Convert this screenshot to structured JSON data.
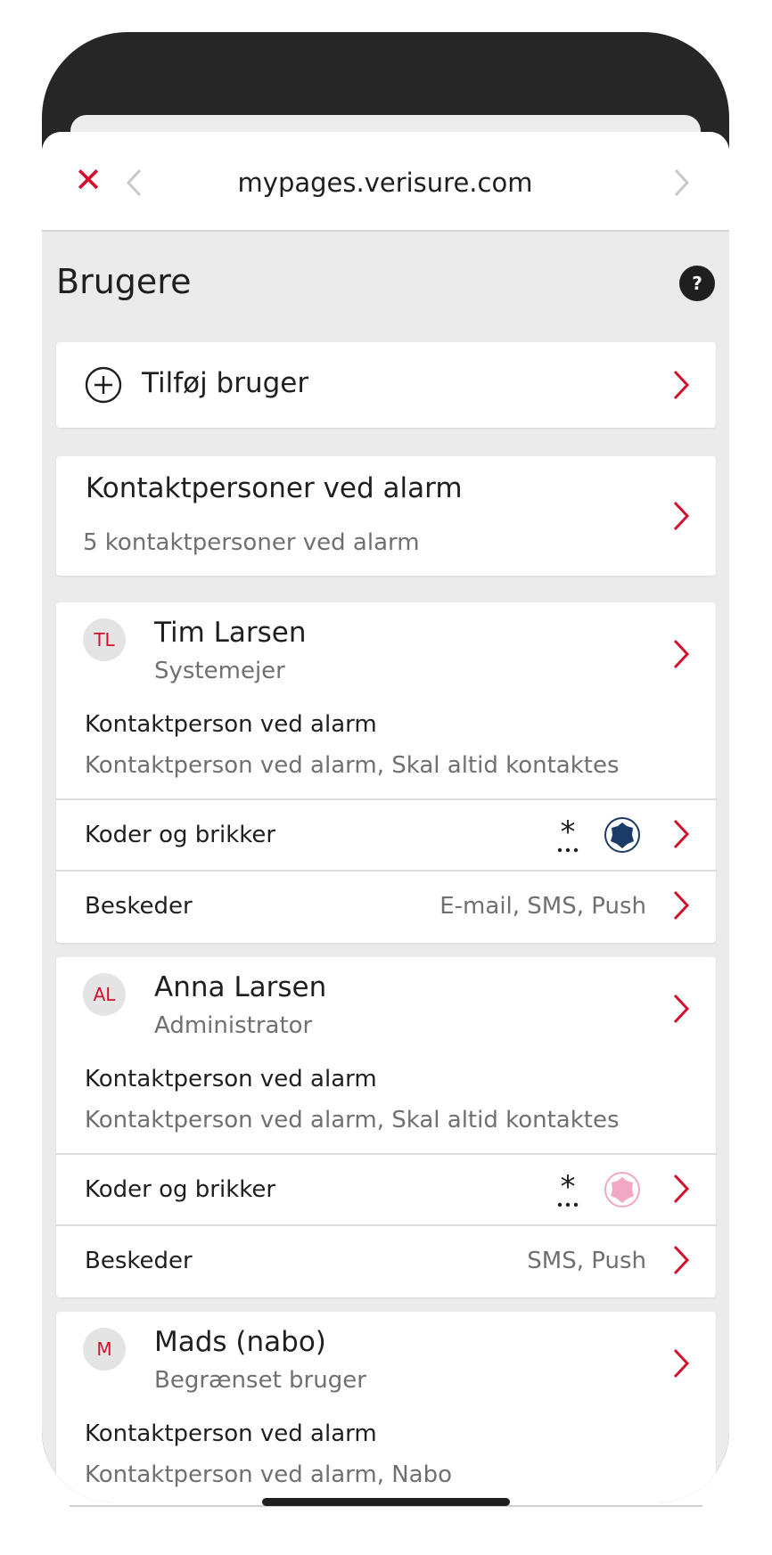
{
  "browser": {
    "url": "mypages.verisure.com",
    "close_icon": "close-icon",
    "accent": "#d4112c"
  },
  "page": {
    "title": "Brugere",
    "help_label": "?"
  },
  "add_user": {
    "label": "Tilføj bruger"
  },
  "alarm_contacts": {
    "title": "Kontaktpersoner ved alarm",
    "subtitle": "5 kontaktpersoner ved alarm"
  },
  "users": [
    {
      "initials": "TL",
      "name": "Tim Larsen",
      "role": "Systemejer",
      "contact_label": "Kontaktperson ved alarm",
      "contact_value": "Kontaktperson ved alarm, Skal altid kontaktes",
      "codes_label": "Koder og brikker",
      "tag_color": "#1b3a66",
      "messages_label": "Beskeder",
      "messages_value": "E-mail, SMS, Push"
    },
    {
      "initials": "AL",
      "name": "Anna Larsen",
      "role": "Administrator",
      "contact_label": "Kontaktperson ved alarm",
      "contact_value": "Kontaktperson ved alarm, Skal altid kontaktes",
      "codes_label": "Koder og brikker",
      "tag_color": "#f2a7c3",
      "messages_label": "Beskeder",
      "messages_value": "SMS, Push"
    },
    {
      "initials": "M",
      "name": "Mads (nabo)",
      "role": "Begrænset bruger",
      "contact_label": "Kontaktperson ved alarm",
      "contact_value": "Kontaktperson ved alarm, Nabo"
    }
  ]
}
